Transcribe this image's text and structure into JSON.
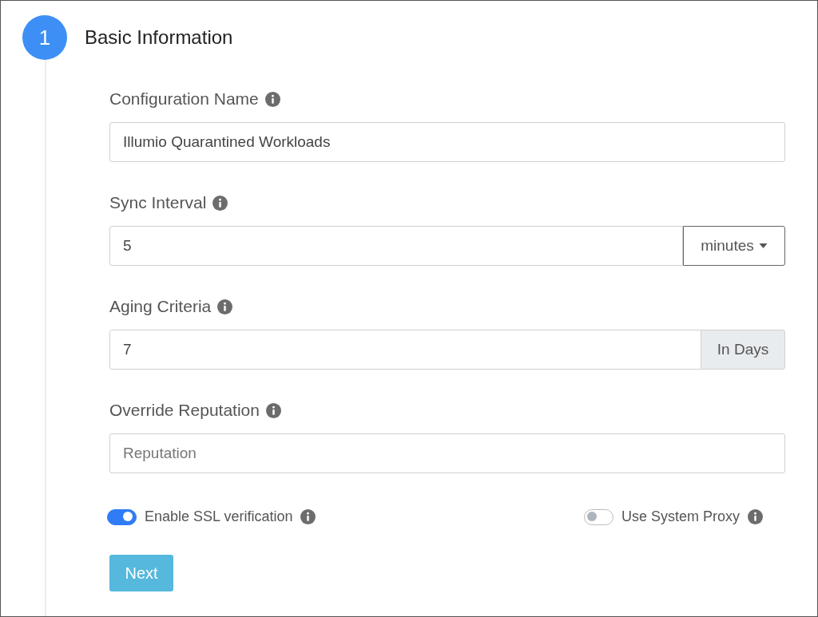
{
  "step": {
    "number": "1",
    "title": "Basic Information"
  },
  "fields": [
    {
      "kind": "text",
      "label": "Configuration Name",
      "value": "Illumio Quarantined Workloads"
    },
    {
      "kind": "dropdown",
      "label": "Sync Interval",
      "value": "5",
      "addon": "minutes"
    },
    {
      "kind": "addon",
      "label": "Aging Criteria",
      "value": "7",
      "addon": "In Days"
    },
    {
      "kind": "text",
      "label": "Override Reputation",
      "placeholder": "Reputation"
    }
  ],
  "toggles": [
    {
      "label": "Enable SSL verification",
      "on": true
    },
    {
      "label": "Use System Proxy",
      "on": false
    }
  ],
  "buttons": [
    "Next"
  ]
}
